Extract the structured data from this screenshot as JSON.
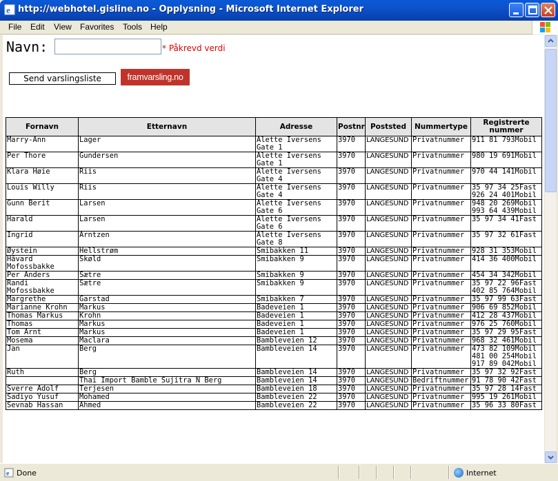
{
  "window": {
    "title": "http://webhotel.gisline.no - Opplysning - Microsoft Internet Explorer",
    "icon": "ie-icon"
  },
  "menu": [
    "File",
    "Edit",
    "View",
    "Favorites",
    "Tools",
    "Help"
  ],
  "form": {
    "name_label": "Navn:",
    "name_value": "",
    "required_text": "* Påkrevd verdi",
    "send_button": "Send varslingsliste",
    "logo_text": "framvarsling.no"
  },
  "table": {
    "headers": [
      "Fornavn",
      "Etternavn",
      "Adresse",
      "Postnr",
      "Poststed",
      "Nummertype",
      "Registrerte nummer"
    ],
    "rows": [
      [
        "Marry-Ann",
        "Lager",
        "Alette Iversens Gate 1",
        "3970",
        "LANGESUND",
        "Privatnummer",
        "911 81 793Mobil"
      ],
      [
        "Per Thore",
        "Gundersen",
        "Alette Iversens Gate 1",
        "3970",
        "LANGESUND",
        "Privatnummer",
        "980 19 691Mobil"
      ],
      [
        "Klara Høie",
        "Riis",
        "Alette Iversens Gate 4",
        "3970",
        "LANGESUND",
        "Privatnummer",
        "970 44 141Mobil"
      ],
      [
        "Louis Willy",
        "Riis",
        "Alette Iversens Gate 4",
        "3970",
        "LANGESUND",
        "Privatnummer",
        "35 97 34 25Fast\n926 24 401Mobil"
      ],
      [
        "Gunn Berit",
        "Larsen",
        "Alette Iversens Gate 6",
        "3970",
        "LANGESUND",
        "Privatnummer",
        "948 20 269Mobil\n993 64 439Mobil"
      ],
      [
        "Harald",
        "Larsen",
        "Alette Iversens Gate 6",
        "3970",
        "LANGESUND",
        "Privatnummer",
        "35 97 34 41Fast"
      ],
      [
        "Ingrid",
        "Arntzen",
        "Alette Iversens Gate 8",
        "3970",
        "LANGESUND",
        "Privatnummer",
        "35 97 32 61Fast"
      ],
      [
        "Øystein",
        "Hellstrøm",
        "Smibakken 11",
        "3970",
        "LANGESUND",
        "Privatnummer",
        "928 31 353Mobil"
      ],
      [
        "Håvard Mofossbakke",
        "Skøld",
        "Smibakken 9",
        "3970",
        "LANGESUND",
        "Privatnummer",
        "414 36 400Mobil"
      ],
      [
        "Per Anders",
        "Sætre",
        "Smibakken 9",
        "3970",
        "LANGESUND",
        "Privatnummer",
        "454 34 342Mobil"
      ],
      [
        "Randi Mofossbakke",
        "Sætre",
        "Smibakken 9",
        "3970",
        "LANGESUND",
        "Privatnummer",
        "35 97 22 96Fast\n402 85 764Mobil"
      ],
      [
        "Margrethe",
        "Garstad",
        "Smibakken 7",
        "3970",
        "LANGESUND",
        "Privatnummer",
        "35 97 99 63Fast"
      ],
      [
        "Marianne Krohn",
        "Markus",
        "Badeveien 1",
        "3970",
        "LANGESUND",
        "Privatnummer",
        "906 69 852Mobil"
      ],
      [
        "Thomas Markus",
        "Krohn",
        "Badeveien 1",
        "3970",
        "LANGESUND",
        "Privatnummer",
        "412 28 437Mobil"
      ],
      [
        "Thomas",
        "Markus",
        "Badeveien 1",
        "3970",
        "LANGESUND",
        "Privatnummer",
        "976 25 760Mobil"
      ],
      [
        "Tom Arnt",
        "Markus",
        "Badeveien 1",
        "3970",
        "LANGESUND",
        "Privatnummer",
        "35 97 29 95Fast"
      ],
      [
        "Mosema",
        "Maclara",
        "Bambleveien 12",
        "3970",
        "LANGESUND",
        "Privatnummer",
        "968 32 461Mobil"
      ],
      [
        "Jan",
        "Berg",
        "Bambleveien 14",
        "3970",
        "LANGESUND",
        "Privatnummer",
        "473 82 109Mobil\n481 00 254Mobil\n917 89 042Mobil"
      ],
      [
        "Ruth",
        "Berg",
        "Bambleveien 14",
        "3970",
        "LANGESUND",
        "Privatnummer",
        "35 97 32 92Fast"
      ],
      [
        "",
        "Thai Import Bamble Sujitra N Berg",
        "Bambleveien 14",
        "3970",
        "LANGESUND",
        "Bedriftnummer",
        "91 78 90 42Fast"
      ],
      [
        "Sverre Adolf",
        "Terjesen",
        "Bambleveien 18",
        "3970",
        "LANGESUND",
        "Privatnummer",
        "35 97 28 14Fast"
      ],
      [
        "Sadiyo Yusuf",
        "Mohamed",
        "Bambleveien 22",
        "3970",
        "LANGESUND",
        "Privatnummer",
        "995 19 261Mobil"
      ],
      [
        "Sevnab Hassan",
        "Ahmed",
        "Bambleveien 22",
        "3970",
        "LANGESUND",
        "Privatnummer",
        "35 96 33 80Fast"
      ]
    ]
  },
  "status": {
    "text": "Done",
    "zone": "Internet"
  }
}
